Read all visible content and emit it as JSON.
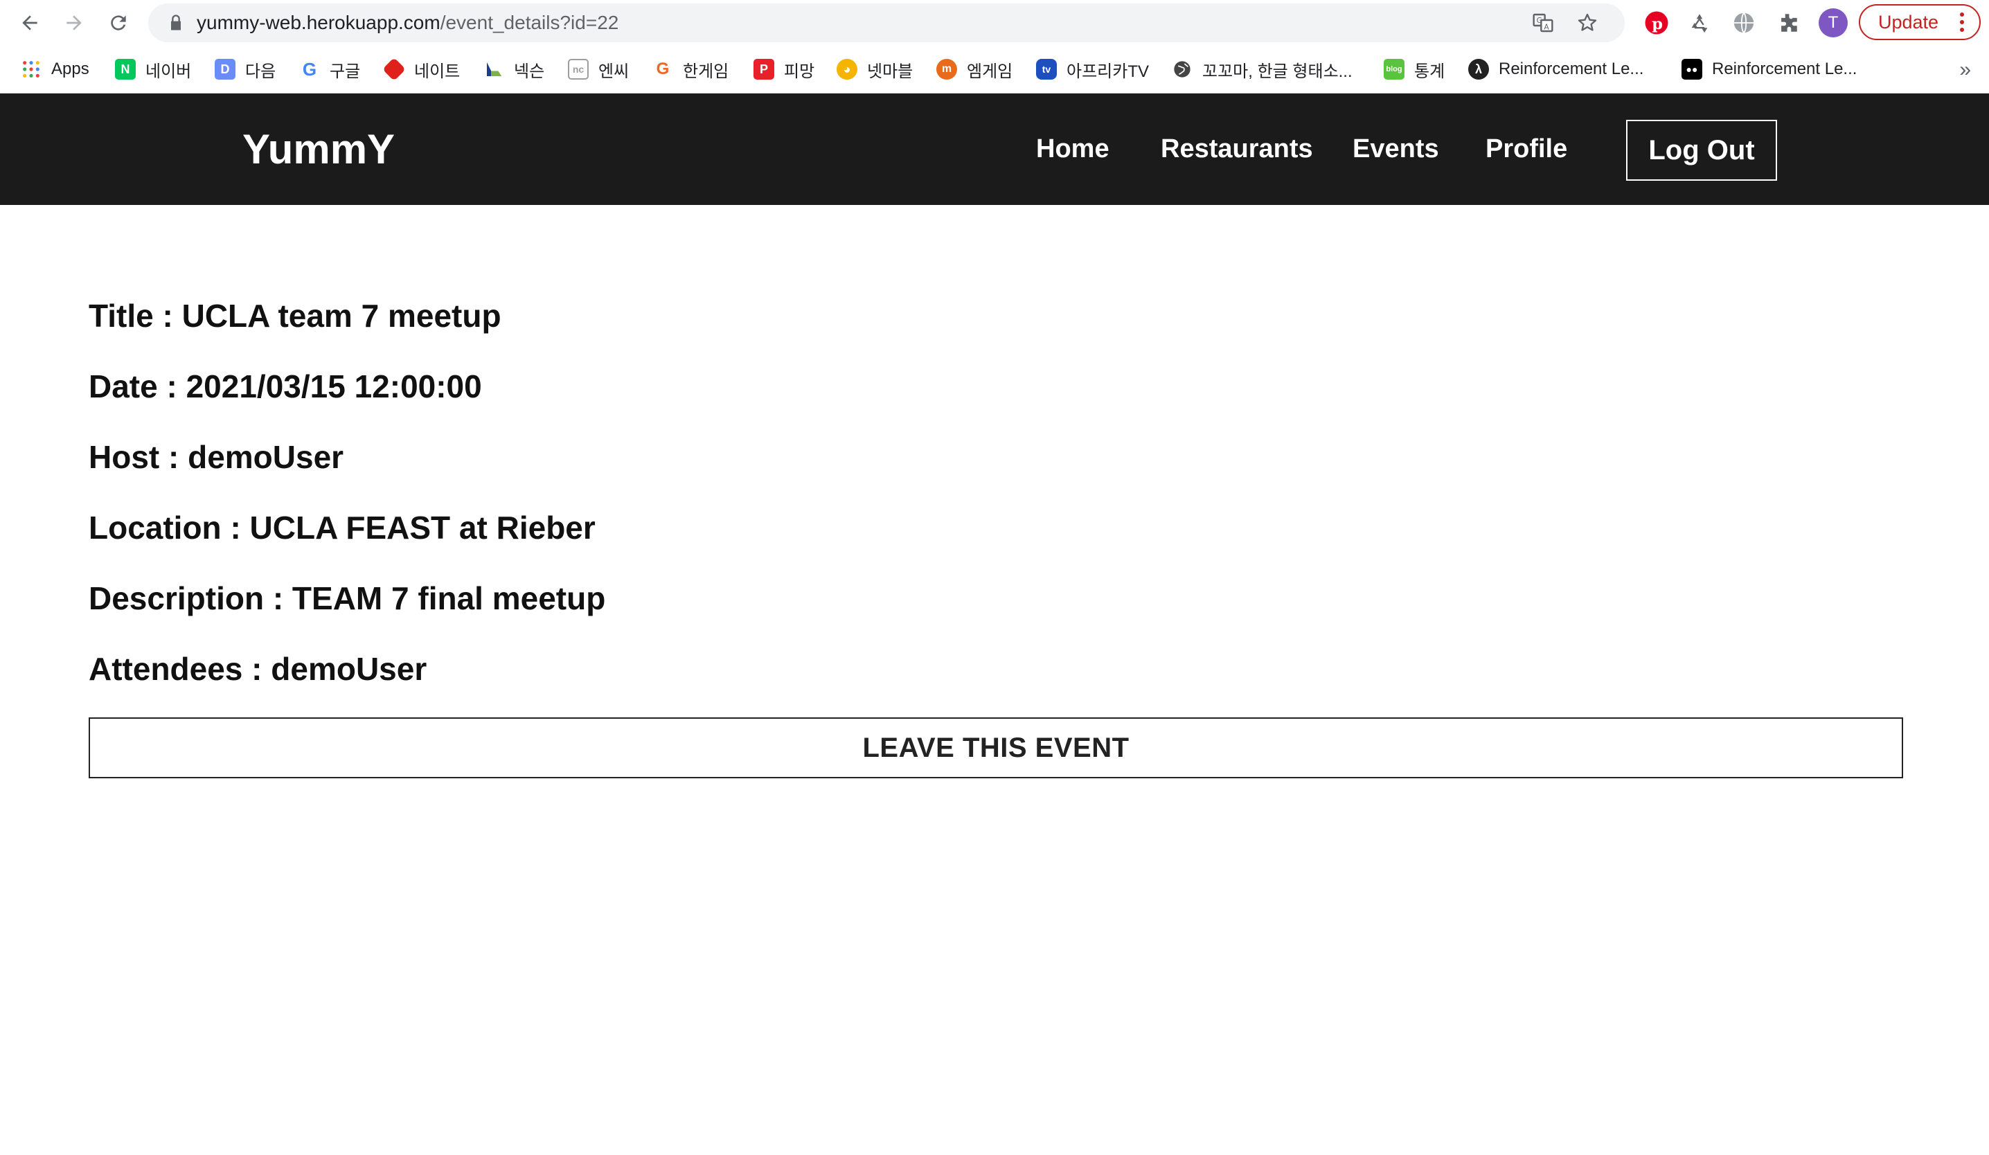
{
  "browser": {
    "url_host": "yummy-web.herokuapp.com",
    "url_path": "/event_details?id=22",
    "avatar_letter": "T",
    "update_label": "Update",
    "bookmarks": [
      {
        "label": "Apps",
        "icon": "apps-grid-icon",
        "color": "#4285f4"
      },
      {
        "label": "네이버",
        "icon": "naver-icon",
        "color": "#03c75a"
      },
      {
        "label": "다음",
        "icon": "daum-icon",
        "color": "#6a8cf7"
      },
      {
        "label": "구글",
        "icon": "google-icon",
        "color": "#4285f4"
      },
      {
        "label": "네이트",
        "icon": "nate-icon",
        "color": "#e0201b"
      },
      {
        "label": "넥슨",
        "icon": "nexon-icon",
        "color": "#1a3e8c"
      },
      {
        "label": "엔씨",
        "icon": "ncsoft-icon",
        "color": "#9e9e9e"
      },
      {
        "label": "한게임",
        "icon": "hangame-icon",
        "color": "#f26522"
      },
      {
        "label": "피망",
        "icon": "pmang-icon",
        "color": "#e8202a"
      },
      {
        "label": "넷마블",
        "icon": "netmarble-icon",
        "color": "#f4b400"
      },
      {
        "label": "엠게임",
        "icon": "mgame-icon",
        "color": "#e86a1a"
      },
      {
        "label": "아프리카TV",
        "icon": "afreecatv-icon",
        "color": "#1e4fbf"
      },
      {
        "label": "꼬꼬마, 한글 형태소...",
        "icon": "globe-icon",
        "color": "#444444"
      },
      {
        "label": "통계",
        "icon": "blog-icon",
        "color": "#5ac43e"
      },
      {
        "label": "Reinforcement Le...",
        "icon": "lambda-icon",
        "color": "#222222"
      },
      {
        "label": "Reinforcement Le...",
        "icon": "medium-icon",
        "color": "#000000"
      }
    ]
  },
  "site": {
    "brand": "YummY",
    "nav": {
      "home": "Home",
      "restaurants": "Restaurants",
      "events": "Events",
      "profile": "Profile",
      "logout": "Log Out"
    }
  },
  "event": {
    "title_line": "Title : UCLA team 7 meetup",
    "date_line": "Date : 2021/03/15 12:00:00",
    "host_line": "Host : demoUser",
    "location_line": "Location : UCLA FEAST at Rieber",
    "description_line": "Description : TEAM 7 final meetup",
    "attendees_line": "Attendees : demoUser",
    "leave_label": "LEAVE THIS EVENT"
  }
}
